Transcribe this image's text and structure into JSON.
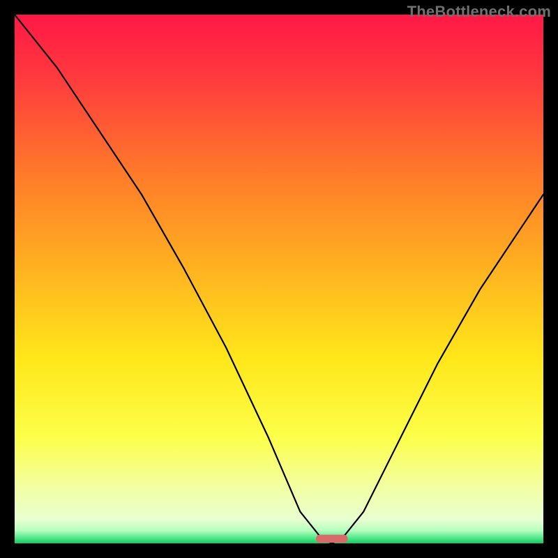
{
  "watermark": "TheBottleneck.com",
  "chart_data": {
    "type": "line",
    "title": "",
    "xlabel": "",
    "ylabel": "",
    "xlim": [
      0,
      100
    ],
    "ylim": [
      0,
      100
    ],
    "grid": false,
    "legend": false,
    "series": [
      {
        "name": "bottleneck-curve",
        "x": [
          0,
          8,
          16,
          24,
          32,
          40,
          48,
          54,
          58,
          60,
          62,
          66,
          72,
          80,
          88,
          96,
          100
        ],
        "y": [
          100,
          90,
          78,
          66,
          52,
          37,
          20,
          6,
          1,
          0,
          1,
          6,
          18,
          34,
          48,
          60,
          66
        ]
      }
    ],
    "marker": {
      "name": "optimal-zone",
      "x_center": 60,
      "width": 6,
      "height": 1.5,
      "color": "#d96a6a"
    },
    "background_gradient": {
      "stops": [
        {
          "offset": 0.0,
          "color": "#ff1846"
        },
        {
          "offset": 0.12,
          "color": "#ff3a3e"
        },
        {
          "offset": 0.3,
          "color": "#ff7a2a"
        },
        {
          "offset": 0.48,
          "color": "#ffb220"
        },
        {
          "offset": 0.65,
          "color": "#ffe71a"
        },
        {
          "offset": 0.8,
          "color": "#fcff4a"
        },
        {
          "offset": 0.9,
          "color": "#f2ffa8"
        },
        {
          "offset": 0.955,
          "color": "#e8ffd0"
        },
        {
          "offset": 0.975,
          "color": "#b8ffc0"
        },
        {
          "offset": 0.99,
          "color": "#4fe88a"
        },
        {
          "offset": 1.0,
          "color": "#16c864"
        }
      ]
    }
  }
}
